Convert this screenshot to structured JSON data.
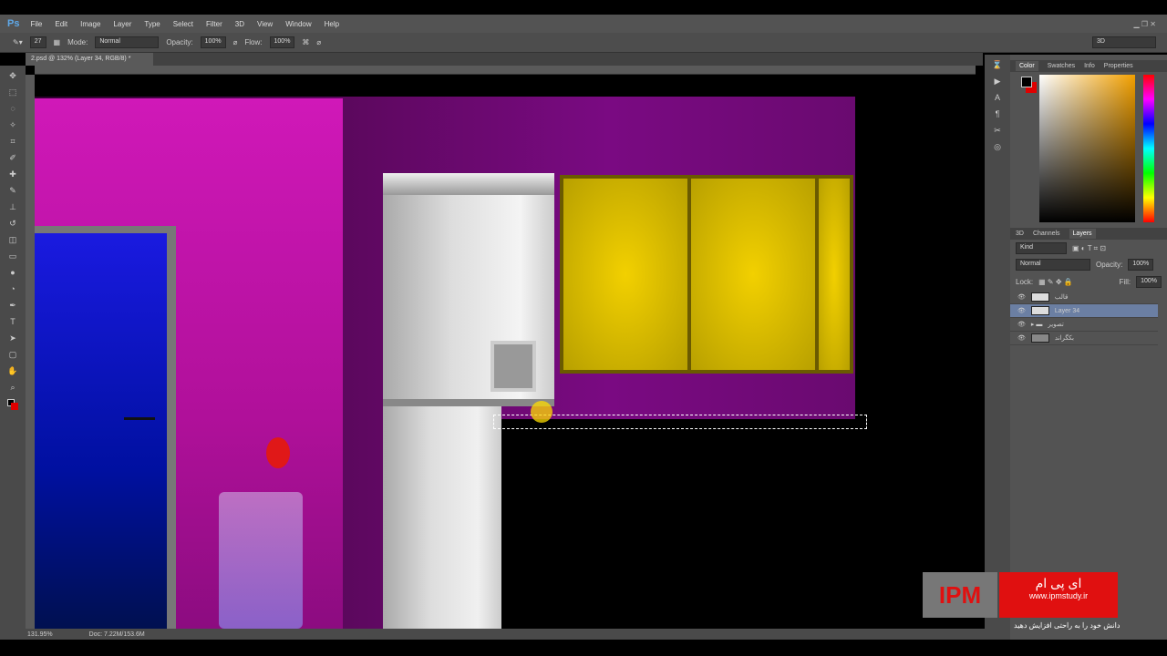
{
  "app": {
    "logo": "Ps",
    "menu": [
      "File",
      "Edit",
      "Image",
      "Layer",
      "Type",
      "Select",
      "Filter",
      "3D",
      "View",
      "Window",
      "Help"
    ],
    "workspace": "3D"
  },
  "options": {
    "brush_size": "27",
    "mode_label": "Mode:",
    "mode": "Normal",
    "opacity_label": "Opacity:",
    "opacity": "100%",
    "flow_label": "Flow:",
    "flow": "100%"
  },
  "document": {
    "tab": "2.psd @ 132% (Layer 34, RGB/8) *"
  },
  "status": {
    "zoom": "131.95%",
    "doc": "Doc: 7.22M/153.6M"
  },
  "color_panel": {
    "tabs": [
      "Color",
      "Swatches",
      "Info",
      "Properties"
    ],
    "foreground": "#000000",
    "background": "#e00000"
  },
  "layers_panel": {
    "tabs": [
      "3D",
      "Channels",
      "Layers"
    ],
    "filter": "Kind",
    "blend": "Normal",
    "opacity_label": "Opacity:",
    "opacity": "100%",
    "lock_label": "Lock:",
    "fill_label": "Fill:",
    "fill": "100%",
    "layers": [
      {
        "name": "قالب"
      },
      {
        "name": "Layer 34",
        "selected": true
      },
      {
        "name": "تصویر",
        "group": true
      },
      {
        "name": "بکگراند"
      }
    ]
  },
  "watermark": {
    "logo": "IPM",
    "brand": "ای پی ام",
    "url": "www.ipmstudy.ir",
    "tagline": "دانش خود را به راحتی افزایش دهید"
  }
}
